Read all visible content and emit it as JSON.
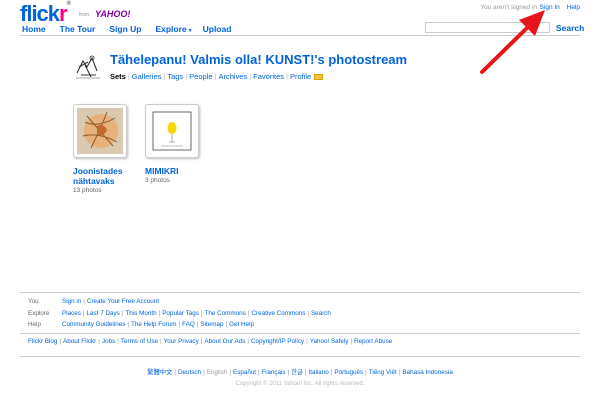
{
  "header": {
    "logo": {
      "b": "flick",
      "p": "r",
      "r": "®"
    },
    "from": "from",
    "yahoo": "YAHOO!",
    "not_signed": "You aren't signed in",
    "sign_in": "Sign In",
    "help": "Help",
    "nav": [
      {
        "label": "Home"
      },
      {
        "label": "The Tour"
      },
      {
        "label": "Sign Up"
      },
      {
        "label": "Explore",
        "has_menu": true
      },
      {
        "label": "Upload"
      }
    ],
    "search_label": "Search",
    "search_value": ""
  },
  "profile": {
    "title": "Tähelepanu! Valmis olla! KUNST!'s photostream",
    "tabs": [
      "Sets",
      "Galleries",
      "Tags",
      "People",
      "Archives",
      "Favorites",
      "Profile"
    ],
    "active_tab": "Sets"
  },
  "sets": [
    {
      "title_line1": "Joonistades",
      "title_line2": "nähtavaks",
      "count": "13 photos"
    },
    {
      "title_line1": "MIMIKRI",
      "title_line2": "",
      "count": "3 photos"
    }
  ],
  "footer": {
    "you": {
      "label": "You",
      "links": [
        "Sign in",
        "Create Your Free Account"
      ]
    },
    "explore": {
      "label": "Explore",
      "links": [
        "Places",
        "Last 7 Days",
        "This Month",
        "Popular Tags",
        "The Commons",
        "Creative Commons",
        "Search"
      ]
    },
    "help": {
      "label": "Help",
      "links": [
        "Community Guidelines",
        "The Help Forum",
        "FAQ",
        "Sitemap",
        "Get Help"
      ]
    },
    "bottom_links": [
      "Flickr Blog",
      "About Flickr",
      "Jobs",
      "Terms of Use",
      "Your Privacy",
      "About Our Ads",
      "Copyright/IP Policy",
      "Yahoo! Safely",
      "Report Abuse"
    ],
    "languages": [
      "繁體中文",
      "Deutsch",
      "English",
      "Español",
      "Français",
      "한글",
      "Italiano",
      "Português",
      "Tiếng Việt",
      "Bahasa Indonesia"
    ],
    "current_language": "English",
    "copyright": "Copyright © 2011 Yahoo! Inc. All rights reserved."
  },
  "colors": {
    "brand_blue": "#0063dc",
    "brand_pink": "#ff0084",
    "arrow_red": "#e8141b"
  }
}
